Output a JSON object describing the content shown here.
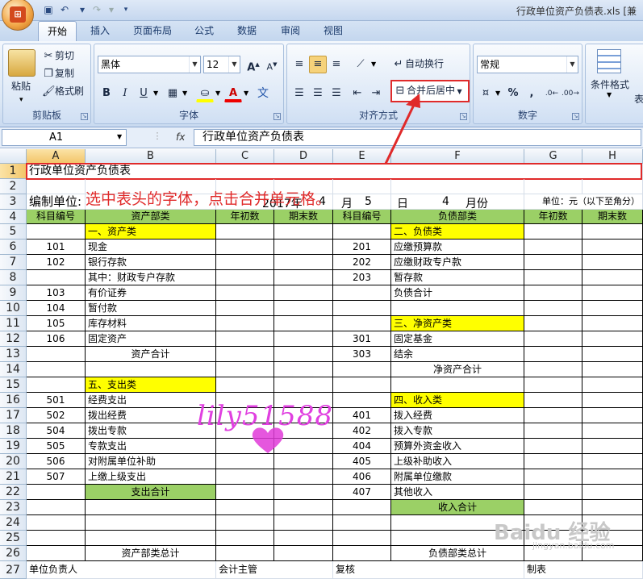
{
  "window": {
    "title": "行政单位资产负债表.xls [兼"
  },
  "tabs": [
    "开始",
    "插入",
    "页面布局",
    "公式",
    "数据",
    "审阅",
    "视图"
  ],
  "ribbon": {
    "clipboard": {
      "paste": "粘贴",
      "cut": "剪切",
      "copy": "复制",
      "format_painter": "格式刷",
      "label": "剪贴板"
    },
    "font": {
      "name": "黑体",
      "size": "12",
      "label": "字体",
      "bold": "B",
      "italic": "I",
      "underline": "U",
      "font_color": "A",
      "grow": "A",
      "shrink": "A",
      "phonetic": "文"
    },
    "alignment": {
      "wrap": "自动换行",
      "merge": "合并后居中",
      "label": "对齐方式"
    },
    "number": {
      "format": "常规",
      "percent": "%",
      "comma": ",",
      "label": "数字"
    },
    "styles": {
      "conditional": "条件格式",
      "table_fmt": "表"
    }
  },
  "formula_bar": {
    "name_box": "A1",
    "fx": "fx",
    "content": "行政单位资产负债表"
  },
  "columns": [
    "A",
    "B",
    "C",
    "D",
    "E",
    "F",
    "G",
    "H"
  ],
  "rows": [
    "1",
    "2",
    "3",
    "4",
    "5",
    "6",
    "7",
    "8",
    "9",
    "10",
    "11",
    "12",
    "13",
    "14",
    "15",
    "16",
    "17",
    "18",
    "19",
    "20",
    "21",
    "22",
    "23",
    "24",
    "25",
    "26",
    "27"
  ],
  "sheet": {
    "r1_title": "行政单位资产负债表",
    "r3": {
      "unit": "编制单位:",
      "year": "2017年",
      "m1": "4",
      "month_label": "月",
      "d1": "5",
      "day_label": "日",
      "m2": "4",
      "month_end": "月份",
      "unit_right": "单位：元（以下至角分）"
    },
    "header": [
      "科目编号",
      "资产部类",
      "年初数",
      "期末数",
      "科目编号",
      "负债部类",
      "年初数",
      "期末数"
    ],
    "left": [
      {
        "code": "",
        "name": "一、资产类",
        "style": "yellow"
      },
      {
        "code": "101",
        "name": "现金"
      },
      {
        "code": "102",
        "name": "银行存款"
      },
      {
        "code": "",
        "name": "其中：财政专户存款"
      },
      {
        "code": "103",
        "name": "有价证券"
      },
      {
        "code": "104",
        "name": "暂付款"
      },
      {
        "code": "105",
        "name": "库存材料"
      },
      {
        "code": "106",
        "name": "固定资产"
      },
      {
        "code": "",
        "name": "资产合计",
        "center": true
      },
      {
        "code": "",
        "name": ""
      },
      {
        "code": "",
        "name": "五、支出类",
        "style": "yellow"
      },
      {
        "code": "501",
        "name": "经费支出"
      },
      {
        "code": "502",
        "name": "拨出经费"
      },
      {
        "code": "504",
        "name": "拨出专款"
      },
      {
        "code": "505",
        "name": "专款支出"
      },
      {
        "code": "506",
        "name": "对附属单位补助"
      },
      {
        "code": "507",
        "name": "上缴上级支出"
      },
      {
        "code": "",
        "name": "支出合计",
        "style": "green",
        "center": true
      }
    ],
    "right": [
      {
        "code": "",
        "name": "二、负债类",
        "style": "yellow"
      },
      {
        "code": "201",
        "name": "应缴预算款"
      },
      {
        "code": "202",
        "name": "应缴财政专户款"
      },
      {
        "code": "203",
        "name": "暂存款"
      },
      {
        "code": "",
        "name": "负债合计"
      },
      {
        "code": "",
        "name": ""
      },
      {
        "code": "",
        "name": "三、净资产类",
        "style": "yellow"
      },
      {
        "code": "301",
        "name": "固定基金"
      },
      {
        "code": "303",
        "name": "结余"
      },
      {
        "code": "",
        "name": "净资产合计",
        "center": true
      },
      {
        "code": "",
        "name": ""
      },
      {
        "code": "",
        "name": "四、收入类",
        "style": "yellow"
      },
      {
        "code": "401",
        "name": "拨入经费"
      },
      {
        "code": "402",
        "name": "拨入专款"
      },
      {
        "code": "404",
        "name": "预算外资金收入"
      },
      {
        "code": "405",
        "name": "上级补助收入"
      },
      {
        "code": "406",
        "name": "附属单位缴款"
      },
      {
        "code": "407",
        "name": "其他收入"
      },
      {
        "code": "",
        "name": "收入合计",
        "style": "green",
        "center": true
      }
    ],
    "r26": {
      "left": "资产部类总计",
      "right": "负债部类总计"
    },
    "r27": {
      "a": "单位负责人",
      "c": "会计主管",
      "e": "复核",
      "g": "制表"
    }
  },
  "annotation": {
    "text": "选中表头的字体，点击合并单元格。"
  },
  "watermark": {
    "text": "lily51588"
  },
  "baidu": {
    "text": "Baidu 经验",
    "sub": "jingyan.baidu.com"
  },
  "colors": {
    "accent": "#e02a2a",
    "header_green": "#9bd066",
    "section_yellow": "#ffff00",
    "watermark": "#e040e0"
  }
}
